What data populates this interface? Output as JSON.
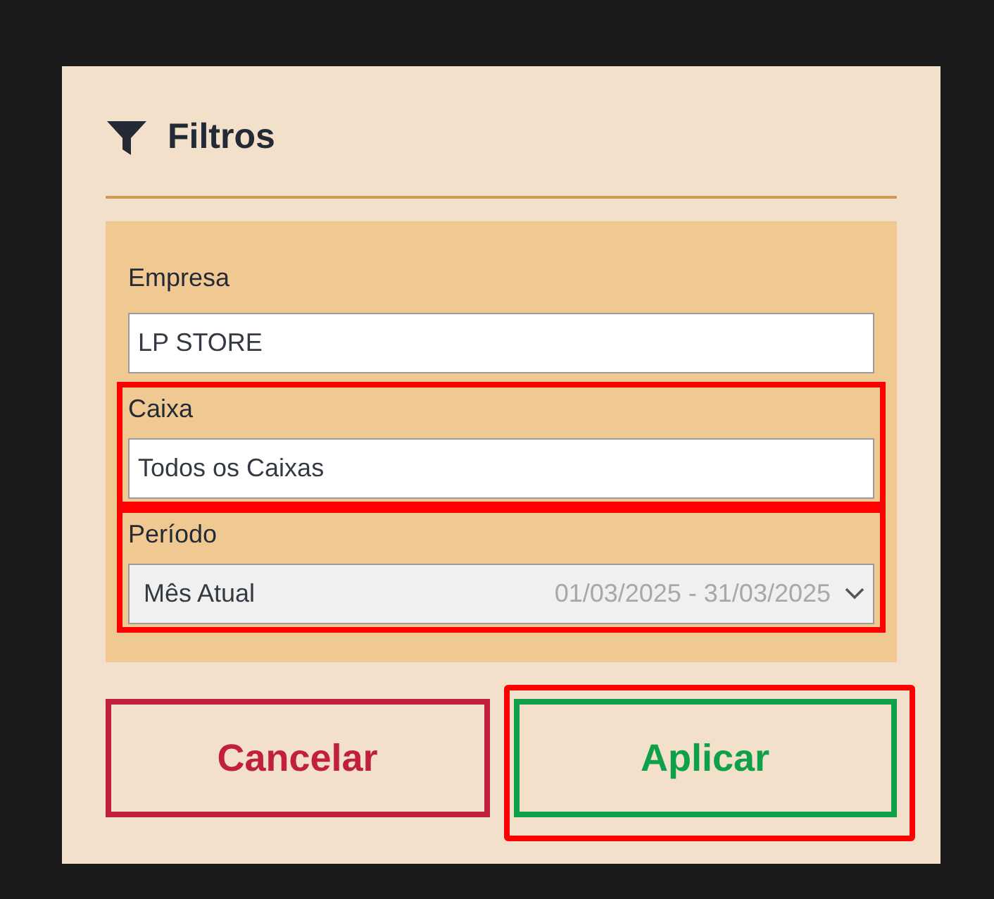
{
  "dialog": {
    "title": "Filtros",
    "fields": [
      {
        "kind": "text",
        "label": "Empresa",
        "value": "LP STORE",
        "highlighted": false
      },
      {
        "kind": "text",
        "label": "Caixa",
        "value": "Todos os Caixas",
        "highlighted": true
      },
      {
        "kind": "select",
        "label": "Período",
        "value": "Mês Atual",
        "range": "01/03/2025 - 31/03/2025",
        "highlighted": true
      }
    ],
    "buttons": [
      {
        "kind": "cancel",
        "label": "Cancelar",
        "highlighted": false
      },
      {
        "kind": "apply",
        "label": "Aplicar",
        "highlighted": true
      }
    ]
  }
}
